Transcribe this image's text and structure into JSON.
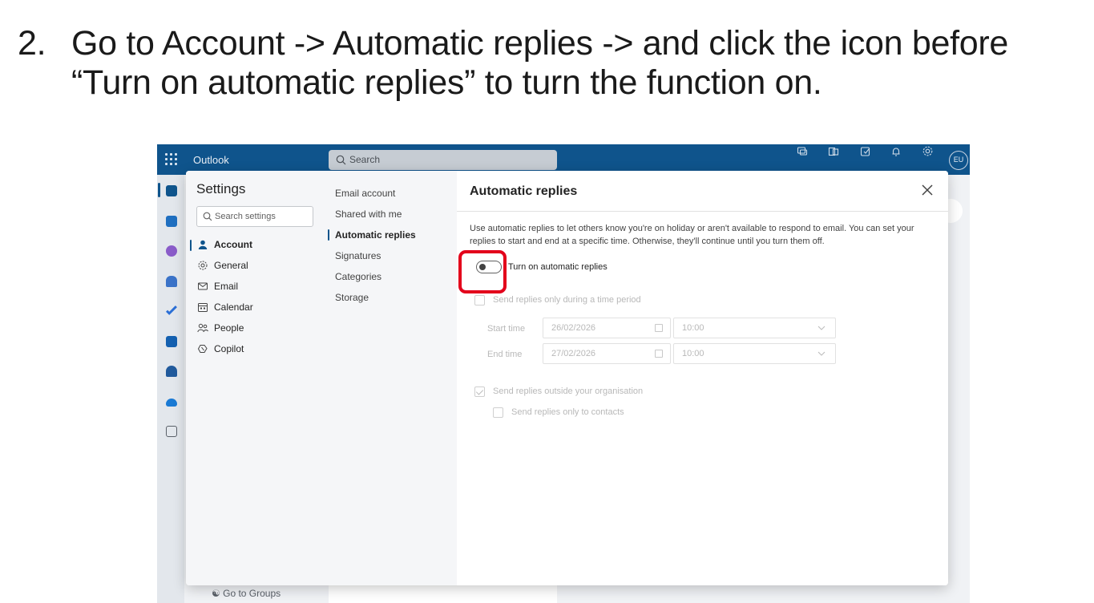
{
  "instruction": {
    "number": "2.",
    "line1": "Go to Account -> Automatic replies -> and click the icon before",
    "line2": "“Turn on automatic replies” to turn the function on."
  },
  "topbar": {
    "app_name": "Outlook",
    "search_placeholder": "Search",
    "avatar_initials": "EU"
  },
  "background": {
    "go_to_groups": "Go to Groups"
  },
  "settings": {
    "title": "Settings",
    "search_placeholder": "Search settings",
    "categories": [
      {
        "label": "Account",
        "icon": "person-icon",
        "selected": true
      },
      {
        "label": "General",
        "icon": "gear-icon",
        "selected": false
      },
      {
        "label": "Email",
        "icon": "mail-icon",
        "selected": false
      },
      {
        "label": "Calendar",
        "icon": "calendar-icon",
        "selected": false
      },
      {
        "label": "People",
        "icon": "people-icon",
        "selected": false
      },
      {
        "label": "Copilot",
        "icon": "copilot-icon",
        "selected": false
      }
    ],
    "subcategories": [
      {
        "label": "Email account",
        "selected": false
      },
      {
        "label": "Shared with me",
        "selected": false
      },
      {
        "label": "Automatic replies",
        "selected": true
      },
      {
        "label": "Signatures",
        "selected": false
      },
      {
        "label": "Categories",
        "selected": false
      },
      {
        "label": "Storage",
        "selected": false
      }
    ]
  },
  "panel": {
    "title": "Automatic replies",
    "description": "Use automatic replies to let others know you're on holiday or aren't available to respond to email. You can set your replies to start and end at a specific time. Otherwise, they'll continue until you turn them off.",
    "toggle_label": "Turn on automatic replies",
    "toggle_on": false,
    "time_period_label": "Send replies only during a time period",
    "start_label": "Start time",
    "start_date": "26/02/2026",
    "start_time": "10:00",
    "end_label": "End time",
    "end_date": "27/02/2026",
    "end_time": "10:00",
    "outside_org_label": "Send replies outside your organisation",
    "outside_org_checked": true,
    "contacts_only_label": "Send replies only to contacts",
    "contacts_only_checked": false
  },
  "colors": {
    "brand_blue": "#0f548c",
    "highlight_red": "#e3001b"
  }
}
